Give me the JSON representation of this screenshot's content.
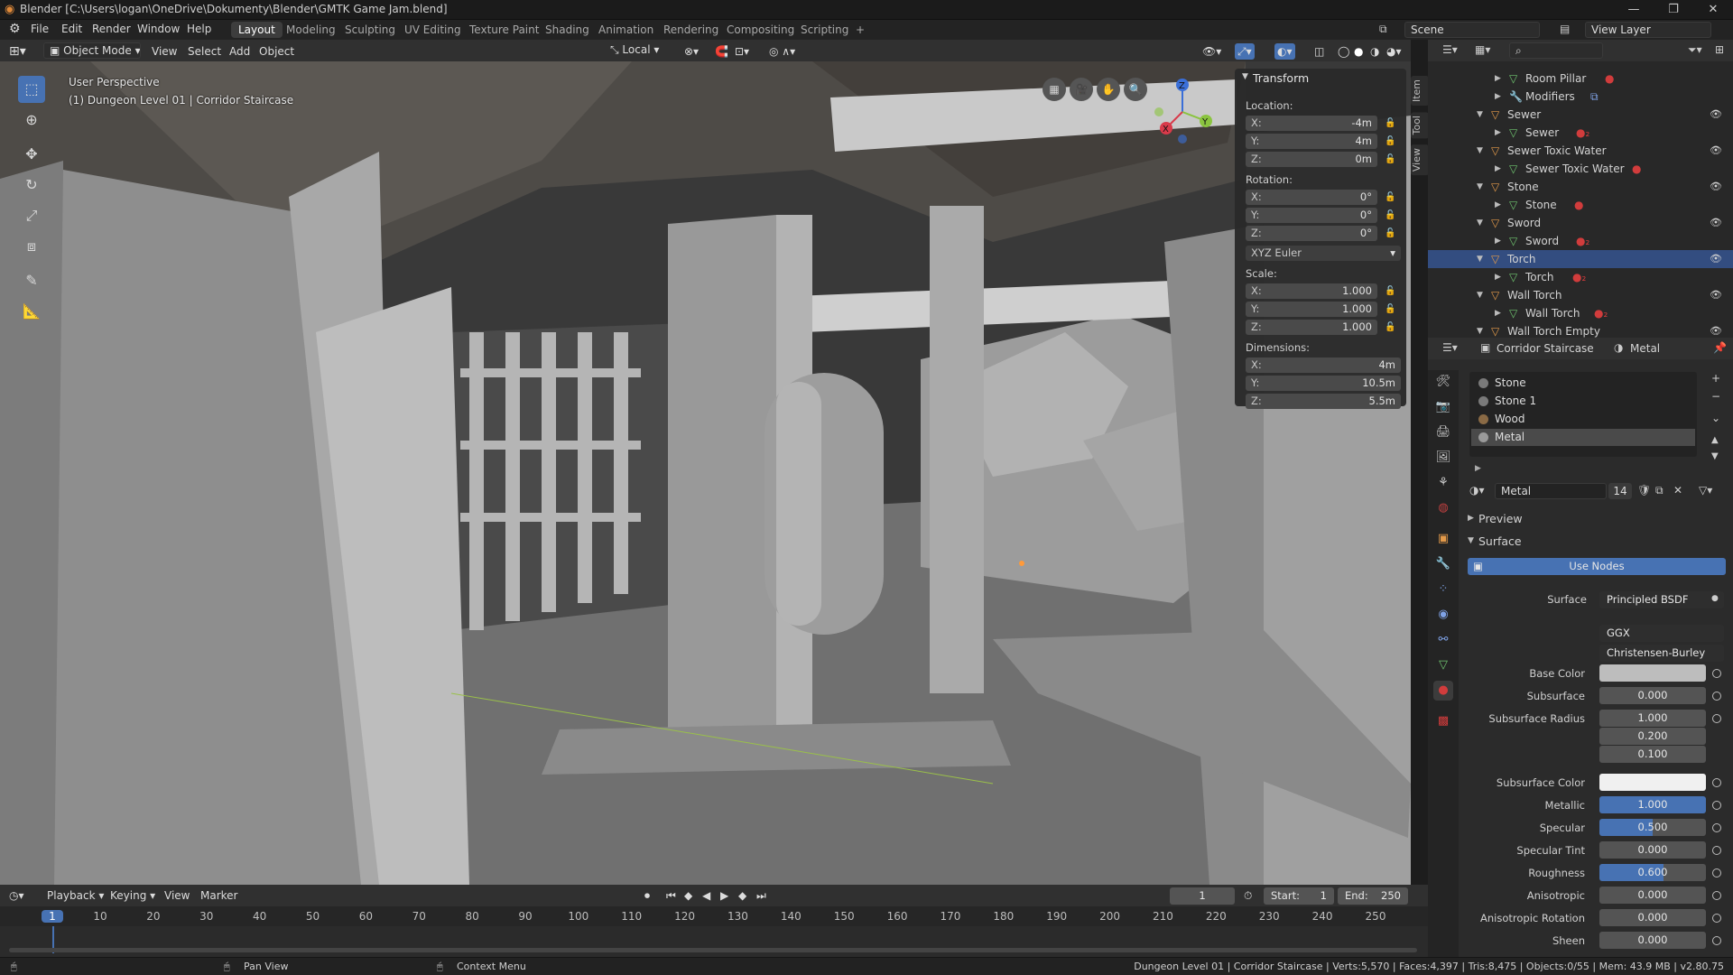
{
  "window": {
    "title": "Blender [C:\\Users\\logan\\OneDrive\\Dokumenty\\Blender\\GMTK Game Jam.blend]",
    "min": "—",
    "max": "❐",
    "close": "✕"
  },
  "menu": {
    "items": [
      "File",
      "Edit",
      "Render",
      "Window",
      "Help"
    ],
    "workspaces": [
      "Layout",
      "Modeling",
      "Sculpting",
      "UV Editing",
      "Texture Paint",
      "Shading",
      "Animation",
      "Rendering",
      "Compositing",
      "Scripting"
    ],
    "active_workspace": "Layout",
    "add_tab": "+",
    "scene": "Scene",
    "view_layer": "View Layer"
  },
  "viewport_header": {
    "mode": "Object Mode",
    "menus": [
      "View",
      "Select",
      "Add",
      "Object"
    ],
    "transform_orientation": "Local"
  },
  "viewport": {
    "perspective": "User Perspective",
    "object_info": "(1) Dungeon Level 01 | Corridor Staircase"
  },
  "npanel": {
    "title": "Transform",
    "location_label": "Location:",
    "location": [
      {
        "axis": "X:",
        "value": "-4m"
      },
      {
        "axis": "Y:",
        "value": "4m"
      },
      {
        "axis": "Z:",
        "value": "0m"
      }
    ],
    "rotation_label": "Rotation:",
    "rotation": [
      {
        "axis": "X:",
        "value": "0°"
      },
      {
        "axis": "Y:",
        "value": "0°"
      },
      {
        "axis": "Z:",
        "value": "0°"
      }
    ],
    "rotation_mode": "XYZ Euler",
    "scale_label": "Scale:",
    "scale": [
      {
        "axis": "X:",
        "value": "1.000"
      },
      {
        "axis": "Y:",
        "value": "1.000"
      },
      {
        "axis": "Z:",
        "value": "1.000"
      }
    ],
    "dimensions_label": "Dimensions:",
    "dimensions": [
      {
        "axis": "X:",
        "value": "4m"
      },
      {
        "axis": "Y:",
        "value": "10.5m"
      },
      {
        "axis": "Z:",
        "value": "5.5m"
      }
    ],
    "tabs": [
      "Item",
      "Tool",
      "View"
    ]
  },
  "outliner": {
    "rows": [
      {
        "label": "Room Pillar",
        "type": "mesh",
        "extra": "material"
      },
      {
        "label": "Modifiers",
        "type": "modifier",
        "extra": "modifier"
      },
      {
        "label": "Sewer",
        "type": "object",
        "extra": "eye"
      },
      {
        "label": "Sewer",
        "type": "mesh",
        "extra": "material2"
      },
      {
        "label": "Sewer Toxic Water",
        "type": "object",
        "extra": "eye"
      },
      {
        "label": "Sewer Toxic Water",
        "type": "mesh",
        "extra": "material"
      },
      {
        "label": "Stone",
        "type": "object",
        "extra": "eye"
      },
      {
        "label": "Stone",
        "type": "mesh",
        "extra": "material"
      },
      {
        "label": "Sword",
        "type": "object",
        "extra": "eye"
      },
      {
        "label": "Sword",
        "type": "mesh",
        "extra": "material2"
      },
      {
        "label": "Torch",
        "type": "object",
        "extra": "eye",
        "selected": true
      },
      {
        "label": "Torch",
        "type": "mesh",
        "extra": "material2"
      },
      {
        "label": "Wall Torch",
        "type": "object",
        "extra": "eye"
      },
      {
        "label": "Wall Torch",
        "type": "mesh",
        "extra": "material2"
      },
      {
        "label": "Wall Torch Empty",
        "type": "object",
        "extra": "eye"
      }
    ]
  },
  "properties": {
    "object": "Corridor Staircase",
    "material": "Metal",
    "material_slots": [
      {
        "name": "Stone",
        "color": "#7a7a7a"
      },
      {
        "name": "Stone 1",
        "color": "#7a7a7a"
      },
      {
        "name": "Wood",
        "color": "#8a6a45"
      },
      {
        "name": "Metal",
        "color": "#9a9a9a",
        "selected": true
      }
    ],
    "material_name": "Metal",
    "users": "14",
    "preview": "Preview",
    "surface_panel": "Surface",
    "use_nodes": "Use Nodes",
    "surface_label": "Surface",
    "surface_shader": "Principled BSDF",
    "distribution": "GGX",
    "subsurface_method": "Christensen-Burley",
    "fields": [
      {
        "label": "Base Color",
        "value": "",
        "kind": "color",
        "color": "#bdbdbd"
      },
      {
        "label": "Subsurface",
        "value": "0.000"
      },
      {
        "label": "Subsurface Radius",
        "value": "1.000"
      },
      {
        "label": "",
        "value": "0.200"
      },
      {
        "label": "",
        "value": "0.100"
      },
      {
        "label": "Subsurface Color",
        "value": "",
        "kind": "color",
        "color": "#f0f0f0"
      },
      {
        "label": "Metallic",
        "value": "1.000",
        "fill": 1.0
      },
      {
        "label": "Specular",
        "value": "0.500",
        "fill": 0.5
      },
      {
        "label": "Specular Tint",
        "value": "0.000"
      },
      {
        "label": "Roughness",
        "value": "0.600",
        "fill": 0.6
      },
      {
        "label": "Anisotropic",
        "value": "0.000"
      },
      {
        "label": "Anisotropic Rotation",
        "value": "0.000"
      },
      {
        "label": "Sheen",
        "value": "0.000"
      }
    ]
  },
  "timeline": {
    "menus": [
      "Playback",
      "Keying",
      "View",
      "Marker"
    ],
    "current_frame": "1",
    "start_label": "Start:",
    "start": "1",
    "end_label": "End:",
    "end": "250",
    "ticks": [
      "1",
      "10",
      "20",
      "30",
      "40",
      "50",
      "60",
      "70",
      "80",
      "90",
      "100",
      "110",
      "120",
      "130",
      "140",
      "150",
      "160",
      "170",
      "180",
      "190",
      "200",
      "210",
      "220",
      "230",
      "240",
      "250"
    ]
  },
  "status": {
    "pan": "Pan View",
    "context": "Context Menu",
    "info": "Dungeon Level 01 | Corridor Staircase | Verts:5,570 | Faces:4,397 | Tris:8,475 | Objects:0/55 | Mem: 43.9 MB | v2.80.75"
  },
  "colors": {
    "accent": "#4772b3",
    "selection": "#334d80",
    "material_red": "#d13c3c",
    "mesh_green": "#6fc46f",
    "object_orange": "#e39a4a"
  }
}
